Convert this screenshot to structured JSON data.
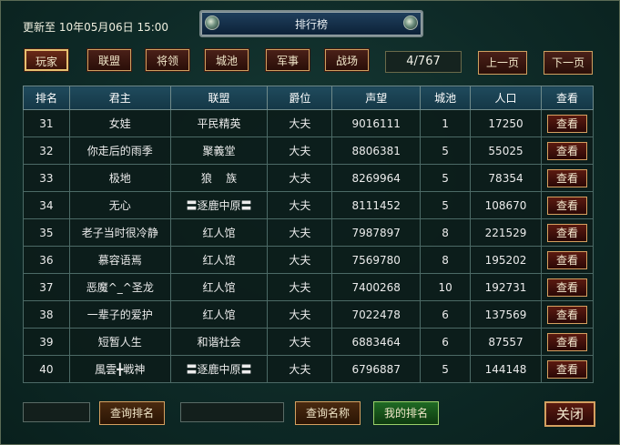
{
  "header": {
    "update_text": "更新至 10年05月06日 15:00",
    "title": "排行榜"
  },
  "categories": [
    {
      "label": "玩家",
      "active": true
    },
    {
      "label": "联盟",
      "active": false
    },
    {
      "label": "将领",
      "active": false
    },
    {
      "label": "城池",
      "active": false
    },
    {
      "label": "军事",
      "active": false
    },
    {
      "label": "战场",
      "active": false
    }
  ],
  "pagination": {
    "page": "4/767",
    "prev_label": "上一页",
    "next_label": "下一页"
  },
  "table": {
    "columns": [
      "排名",
      "君主",
      "联盟",
      "爵位",
      "声望",
      "城池",
      "人口",
      "查看"
    ],
    "view_label": "查看",
    "rows": [
      {
        "rank": "31",
        "lord": "女娃",
        "alliance": "平民精英",
        "title": "大夫",
        "prestige": "9016111",
        "cities": "1",
        "population": "17250"
      },
      {
        "rank": "32",
        "lord": "你走后的雨季",
        "alliance": "聚義堂",
        "title": "大夫",
        "prestige": "8806381",
        "cities": "5",
        "population": "55025"
      },
      {
        "rank": "33",
        "lord": "极地",
        "alliance": "狼    族",
        "title": "大夫",
        "prestige": "8269964",
        "cities": "5",
        "population": "78354"
      },
      {
        "rank": "34",
        "lord": "无心",
        "alliance": "〓逐鹿中原〓",
        "title": "大夫",
        "prestige": "8111452",
        "cities": "5",
        "population": "108670"
      },
      {
        "rank": "35",
        "lord": "老子当时很冷静",
        "alliance": "红人馆",
        "title": "大夫",
        "prestige": "7987897",
        "cities": "8",
        "population": "221529"
      },
      {
        "rank": "36",
        "lord": "慕容语焉",
        "alliance": "红人馆",
        "title": "大夫",
        "prestige": "7569780",
        "cities": "8",
        "population": "195202"
      },
      {
        "rank": "37",
        "lord": "恶魔^_^圣龙",
        "alliance": "红人馆",
        "title": "大夫",
        "prestige": "7400268",
        "cities": "10",
        "population": "192731"
      },
      {
        "rank": "38",
        "lord": "一辈子的爱护",
        "alliance": "红人馆",
        "title": "大夫",
        "prestige": "7022478",
        "cities": "6",
        "population": "137569"
      },
      {
        "rank": "39",
        "lord": "短暂人生",
        "alliance": "和谐社会",
        "title": "大夫",
        "prestige": "6883464",
        "cities": "6",
        "population": "87557"
      },
      {
        "rank": "40",
        "lord": "風雲╋戦神",
        "alliance": "〓逐鹿中原〓",
        "title": "大夫",
        "prestige": "6796887",
        "cities": "5",
        "population": "144148"
      }
    ]
  },
  "footer": {
    "query_rank_label": "查询排名",
    "query_name_label": "查询名称",
    "my_rank_label": "我的排名",
    "close_label": "关闭"
  }
}
